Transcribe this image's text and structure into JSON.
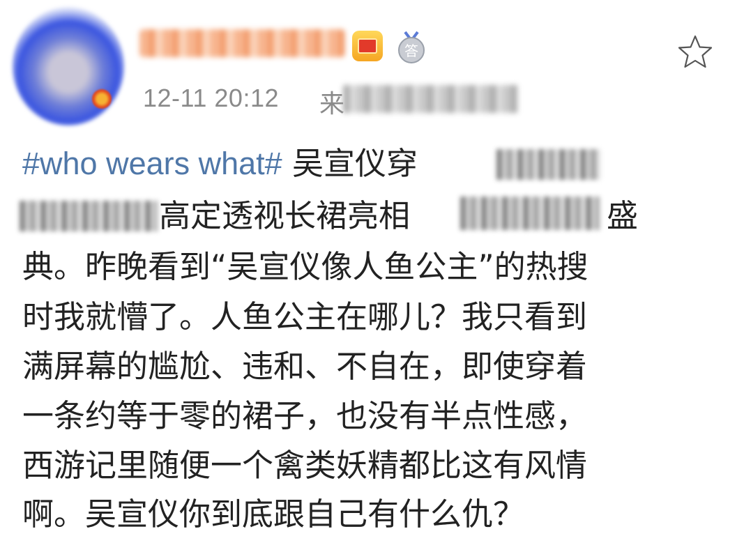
{
  "post": {
    "meta": {
      "timestamp": "12-11 20:12",
      "source_prefix": "来"
    },
    "icons": {
      "avatar": "avatar-image",
      "crown": "vip-crown-icon",
      "medal": "answer-medal-icon",
      "medal_text": "答",
      "favorite": "star-outline-icon"
    },
    "content": {
      "hashtag": "#who wears what#",
      "line1_text": " 吴宣仪穿",
      "line2_text": "高定透视长裙亮相",
      "line2_end": "盛",
      "line3": "典。昨晚看到“吴宣仪像人鱼公主”的热搜",
      "line4": "时我就懵了。人鱼公主在哪儿？我只看到",
      "line5": "满屏幕的尴尬、违和、不自在，即使穿着",
      "line6": "一条约等于零的裙子，也没有半点性感，",
      "line7": "西游记里随便一个禽类妖精都比这有风情",
      "line8": "啊。吴宣仪你到底跟自己有什么仇？"
    },
    "colors": {
      "hashtag": "#4f77a8",
      "meta": "#8a8a8a",
      "text": "#222222"
    }
  }
}
